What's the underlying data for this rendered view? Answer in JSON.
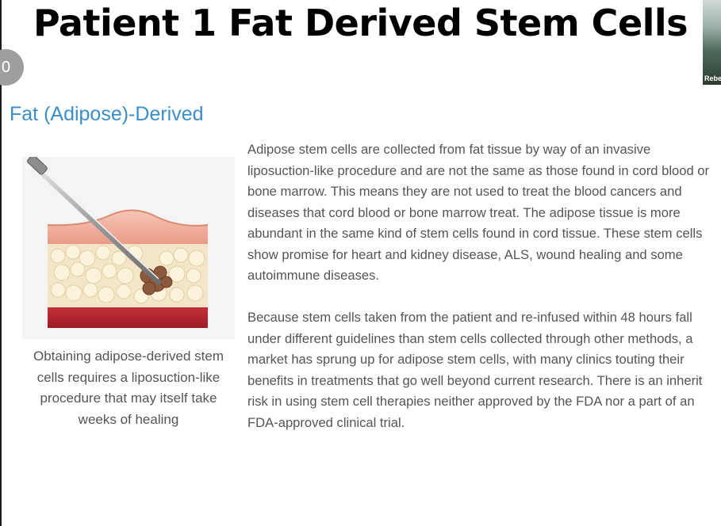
{
  "slide": {
    "title": "Patient 1 Fat Derived Stem Cells",
    "counter": "0",
    "participant_name": "Rebe"
  },
  "section": {
    "heading": "Fat (Adipose)-Derived",
    "caption": "Obtaining adipose-derived stem cells requires a liposuction-like procedure that may itself take weeks of healing",
    "paragraphs": [
      "Adipose stem cells are collected from fat tissue by way of an invasive liposuction-like procedure and are not the same as those found in cord blood or bone marrow. This means they are not used to treat the blood cancers and diseases that cord blood or bone marrow treat. The adipose tissue is more abundant in the same kind of stem cells found in cord tissue. These stem cells show promise for heart and kidney disease, ALS, wound healing and some autoimmune diseases.",
      "Because stem cells taken from the patient and re-infused within 48 hours fall under different guidelines than stem cells collected through other methods, a market has sprung up for adipose stem cells, with many clinics touting their benefits in treatments that go well beyond current research. There is an inherit risk in using stem cell therapies neither approved by the FDA nor a part of an FDA-approved clinical trial."
    ]
  },
  "colors": {
    "heading": "#3b8ec6",
    "body_text": "#555555",
    "title": "#000000"
  },
  "icons": {
    "illustration": "liposuction-cannula-skin-illustration"
  }
}
